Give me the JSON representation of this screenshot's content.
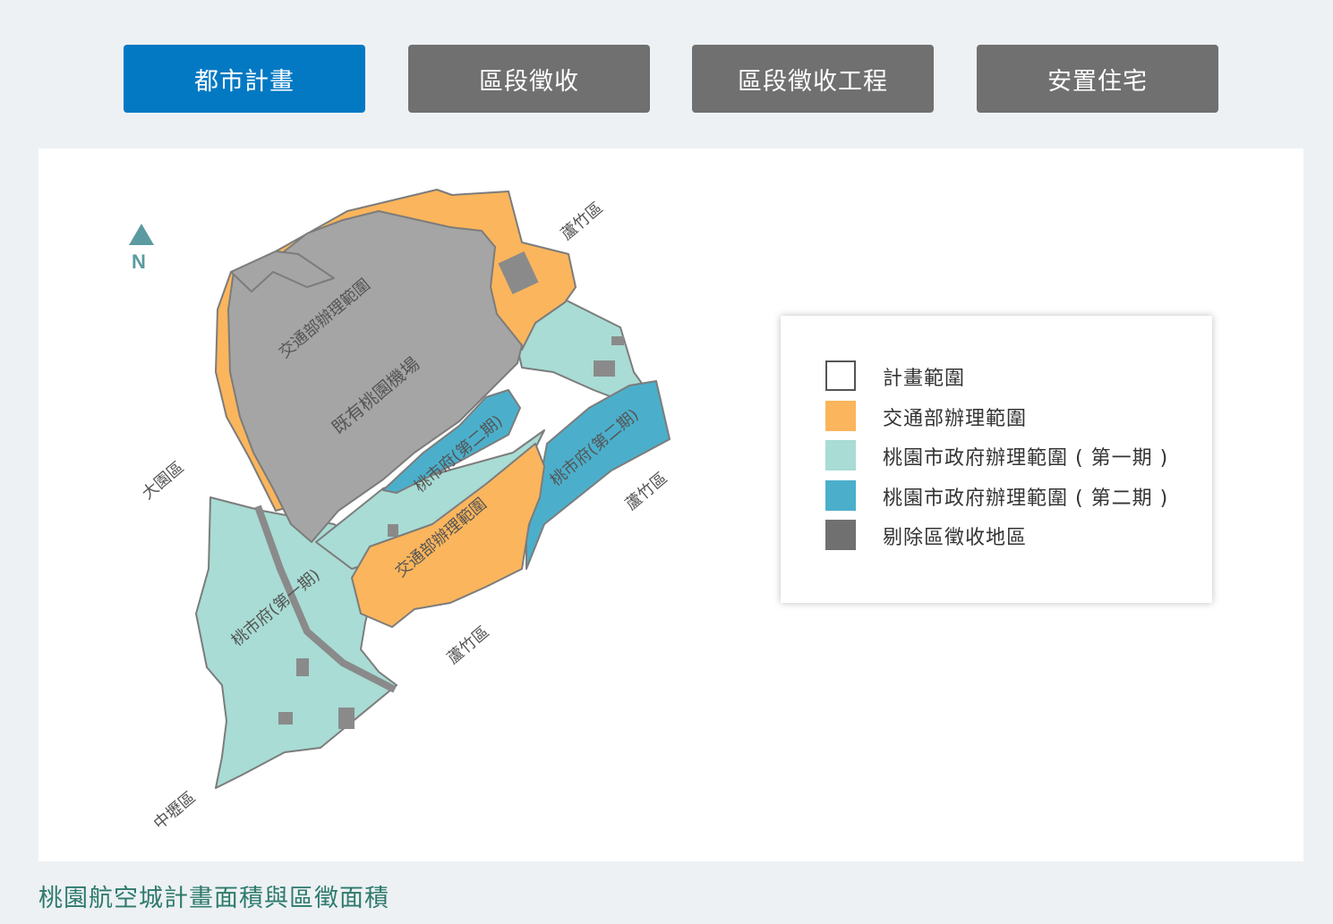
{
  "tabs": [
    {
      "label": "都市計畫",
      "active": true
    },
    {
      "label": "區段徵收",
      "active": false
    },
    {
      "label": "區段徵收工程",
      "active": false
    },
    {
      "label": "安置住宅",
      "active": false
    }
  ],
  "colors": {
    "active_tab": "#0479c3",
    "inactive_tab": "#707070",
    "orange": "#fbb55c",
    "light_teal": "#a8dcd4",
    "blue": "#4bafcb",
    "gray": "#a5a5a5",
    "dark_gray": "#707070"
  },
  "map": {
    "north": "N",
    "labels": {
      "airport": "既有桃園機場",
      "moc_north": "交通部辦理範圍",
      "moc_south": "交通部辦理範圍",
      "phase2_a": "桃市府(第二期)",
      "phase2_b": "桃市府(第二期)",
      "phase1": "桃市府(第一期)",
      "luzhu_top": "蘆竹區",
      "luzhu_right": "蘆竹區",
      "luzhu_bottom": "蘆竹區",
      "dayuan": "大園區",
      "zhongli": "中壢區"
    }
  },
  "legend": [
    {
      "label": "計畫範圍",
      "swatch": "outline"
    },
    {
      "label": "交通部辦理範圍",
      "swatch": "orange"
    },
    {
      "label": "桃園市政府辦理範圍 ( 第一期 )",
      "swatch": "light_teal"
    },
    {
      "label": "桃園市政府辦理範圍 ( 第二期 )",
      "swatch": "blue"
    },
    {
      "label": "剔除區徵收地區",
      "swatch": "dark_gray"
    }
  ],
  "caption": "桃園航空城計畫面積與區徵面積"
}
